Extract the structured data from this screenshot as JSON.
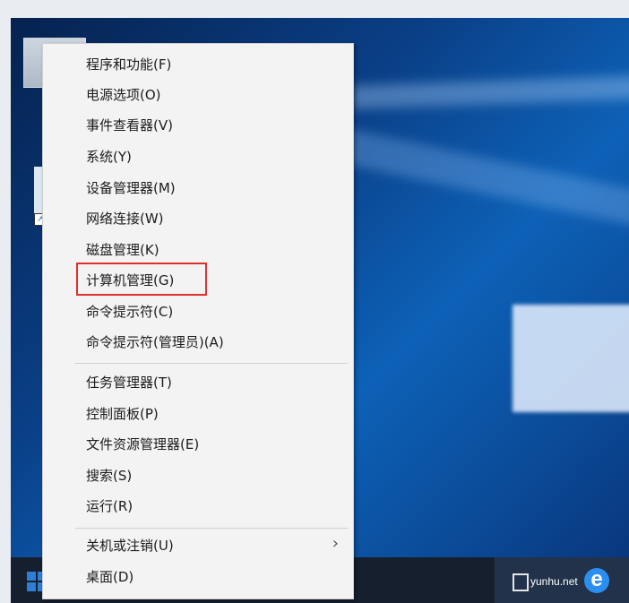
{
  "menu": {
    "items": [
      {
        "label": "程序和功能(F)"
      },
      {
        "label": "电源选项(O)"
      },
      {
        "label": "事件查看器(V)"
      },
      {
        "label": "系统(Y)"
      },
      {
        "label": "设备管理器(M)"
      },
      {
        "label": "网络连接(W)"
      },
      {
        "label": "磁盘管理(K)"
      },
      {
        "label": "计算机管理(G)",
        "highlighted": true
      },
      {
        "label": "命令提示符(C)"
      },
      {
        "label": "命令提示符(管理员)(A)"
      },
      {
        "label": "任务管理器(T)"
      },
      {
        "label": "控制面板(P)"
      },
      {
        "label": "文件资源管理器(E)"
      },
      {
        "label": "搜索(S)"
      },
      {
        "label": "运行(R)"
      },
      {
        "label": "关机或注销(U)",
        "submenu": true
      },
      {
        "label": "桌面(D)"
      }
    ],
    "highlight_color": "#e0302c"
  },
  "taskbar": {
    "watermark": "yunhu.net",
    "start_icon": "windows-logo-icon",
    "browser_icon": "edge-icon",
    "task_view_icon": "task-view-icon"
  },
  "desktop": {
    "accent": "#0d61b7"
  }
}
